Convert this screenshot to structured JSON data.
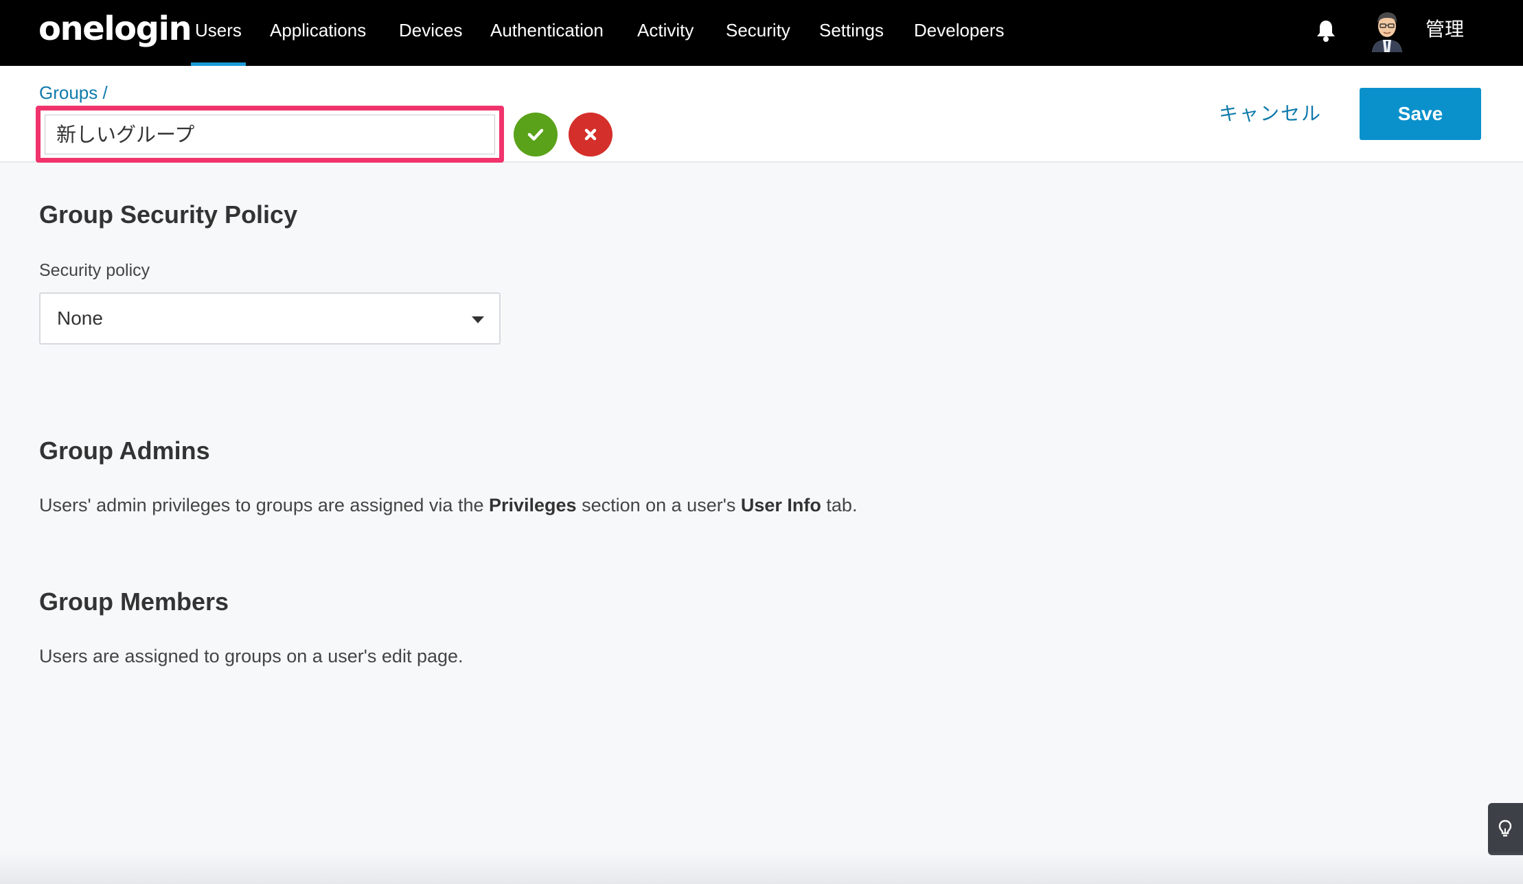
{
  "nav": {
    "logo": "onelogin",
    "items": [
      {
        "label": "Users",
        "active": true
      },
      {
        "label": "Applications",
        "active": false
      },
      {
        "label": "Devices",
        "active": false
      },
      {
        "label": "Authentication",
        "active": false
      },
      {
        "label": "Activity",
        "active": false
      },
      {
        "label": "Security",
        "active": false
      },
      {
        "label": "Settings",
        "active": false
      },
      {
        "label": "Developers",
        "active": false
      }
    ],
    "user_label": "管理"
  },
  "header": {
    "breadcrumb": "Groups /",
    "group_name_value": "新しいグループ",
    "cancel_label": "キャンセル",
    "save_label": "Save"
  },
  "security_policy": {
    "title": "Group Security Policy",
    "field_label": "Security policy",
    "selected": "None"
  },
  "admins": {
    "title": "Group Admins",
    "text_1": "Users' admin privileges to groups are assigned via the ",
    "bold_1": "Privileges",
    "text_2": " section on a user's ",
    "bold_2": "User Info",
    "text_3": " tab."
  },
  "members": {
    "title": "Group Members",
    "text": "Users are assigned to groups on a user's edit page."
  },
  "icons": {
    "notifications": "bell-icon",
    "help": "lightbulb-icon",
    "confirm": "check-icon",
    "discard": "close-icon"
  },
  "colors": {
    "nav_bg": "#000000",
    "accent": "#0a91cc",
    "link": "#0f7aab",
    "focus_border": "#f0336c",
    "confirm": "#5aa21a",
    "discard": "#d42f2a"
  }
}
